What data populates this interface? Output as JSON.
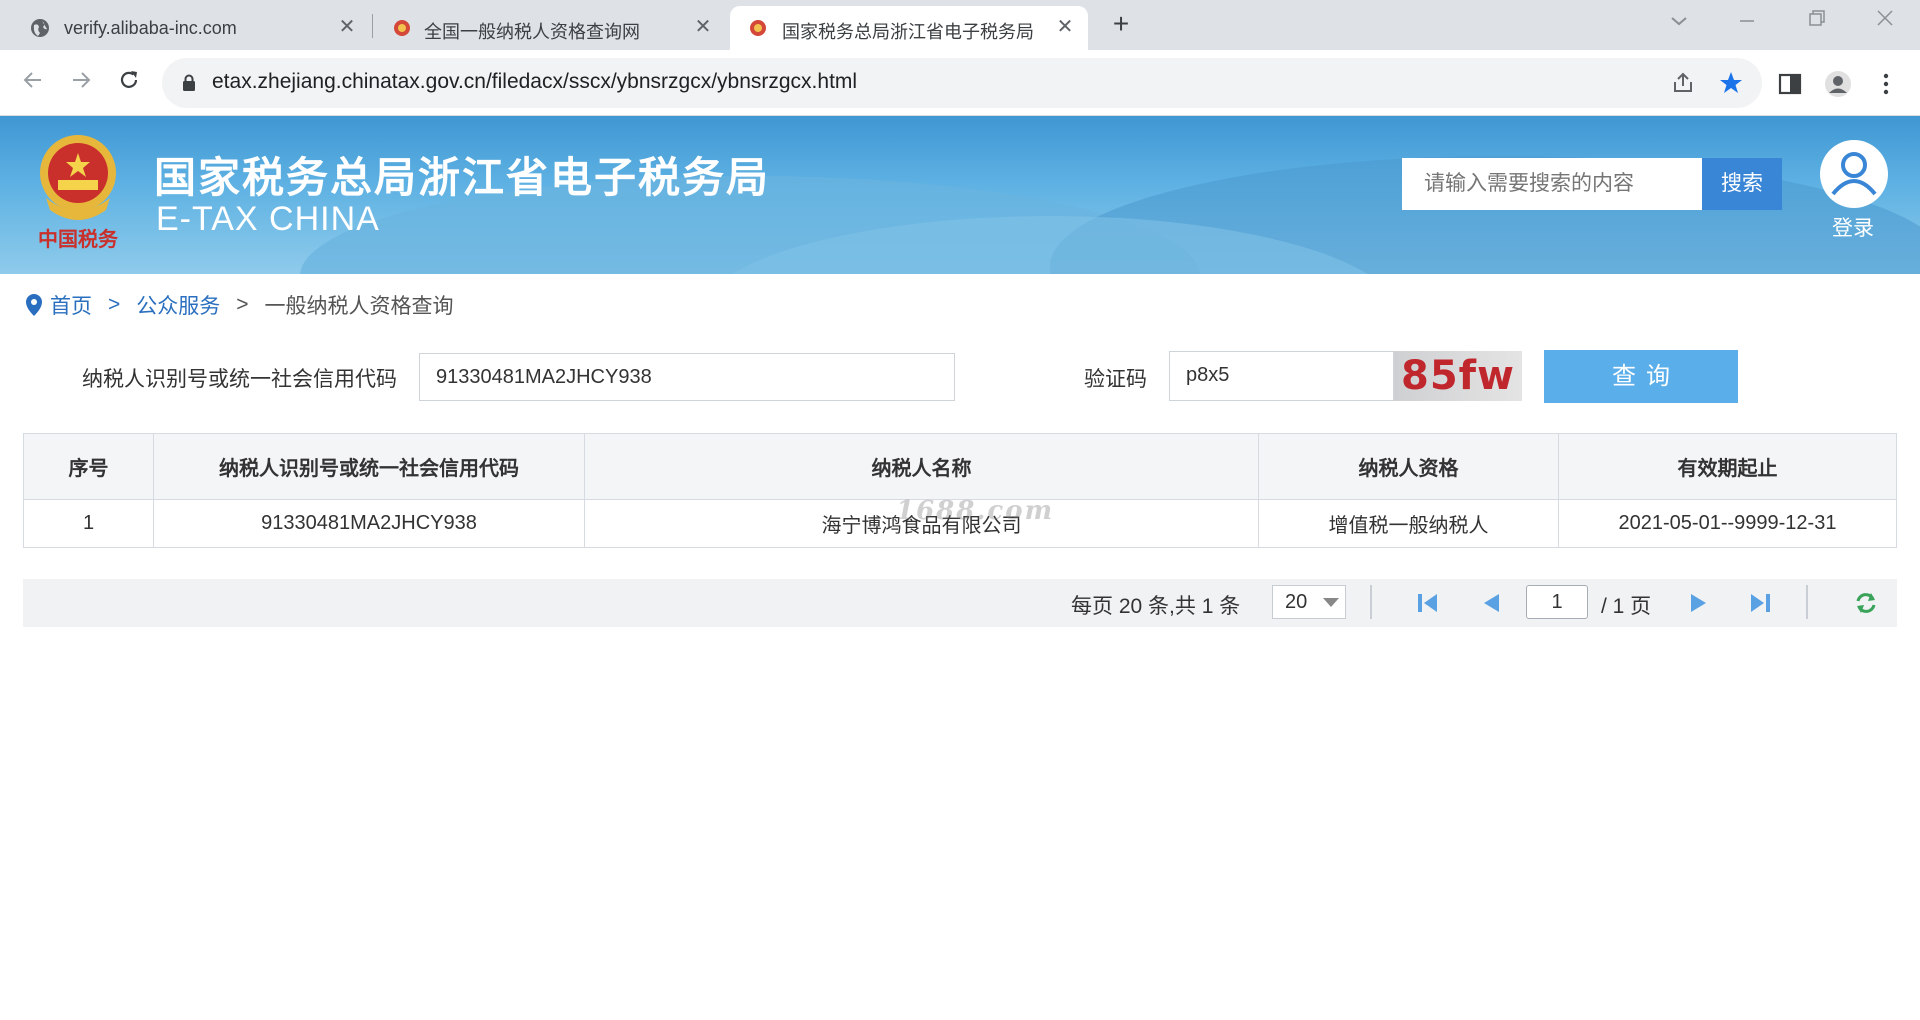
{
  "browser": {
    "tabs": [
      {
        "title": "verify.alibaba-inc.com",
        "close": "✕",
        "favicon": "globe-icon"
      },
      {
        "title": "全国一般纳税人资格查询网",
        "close": "✕",
        "favicon": "tax-emblem-icon"
      },
      {
        "title": "国家税务总局浙江省电子税务局",
        "close": "✕",
        "favicon": "tax-emblem-icon"
      }
    ],
    "new_tab": "+",
    "url": "etax.zhejiang.chinatax.gov.cn/filedacx/sscx/ybnsrzgcx/ybnsrzgcx.html"
  },
  "header": {
    "title": "国家税务总局浙江省电子税务局",
    "subtitle": "E-TAX CHINA",
    "emblem_text": "中国税务",
    "search_placeholder": "请输入需要搜索的内容",
    "search_button": "搜索",
    "login_label": "登录"
  },
  "breadcrumb": {
    "home": "首页",
    "sep": ">",
    "section": "公众服务",
    "current": "一般纳税人资格查询"
  },
  "form": {
    "taxpayer_id_label": "纳税人识别号或统一社会信用代码",
    "taxpayer_id_value": "91330481MA2JHCY938",
    "captcha_label": "验证码",
    "captcha_value": "p8x5",
    "captcha_image_text": "85fw",
    "query_button": "查询"
  },
  "table": {
    "headers": [
      "序号",
      "纳税人识别号或统一社会信用代码",
      "纳税人名称",
      "纳税人资格",
      "有效期起止"
    ],
    "rows": [
      [
        "1",
        "91330481MA2JHCY938",
        "海宁博鸿食品有限公司",
        "增值税一般纳税人",
        "2021-05-01--9999-12-31"
      ]
    ],
    "watermark": "1688.com"
  },
  "pager": {
    "info": "每页 20 条,共 1 条",
    "page_size": "20",
    "current_page": "1",
    "total_pages": "/ 1 页"
  },
  "colors": {
    "accent": "#3a86d6",
    "query_button": "#5aaeea",
    "link": "#2a6fbf",
    "captcha_text": "#c0272d"
  }
}
